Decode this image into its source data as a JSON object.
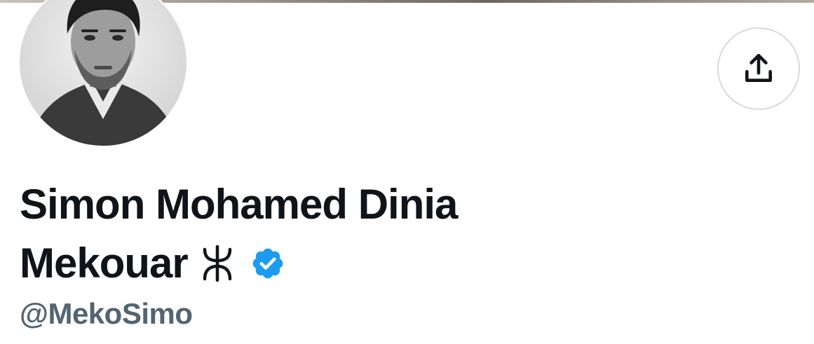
{
  "profile": {
    "display_name_line1": "Simon Mohamed Dinia",
    "display_name_line2": "Mekouar",
    "name_symbol": "ⵣ",
    "handle": "@MekoSimo",
    "verified": true
  },
  "header": {
    "share_icon": "share-upload-icon"
  },
  "icons": {
    "verified": "verified-badge-icon",
    "avatar": "profile-photo"
  },
  "colors": {
    "name_text": "#0f1419",
    "handle_text": "#536471",
    "verified_blue": "#1d9bf0",
    "button_border": "#d6dbdf"
  }
}
